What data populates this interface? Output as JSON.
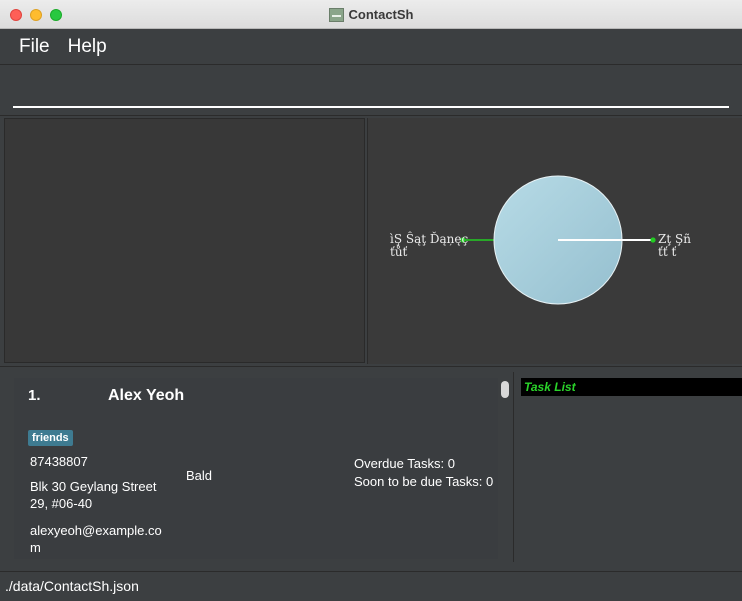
{
  "window": {
    "title": "ContactSh"
  },
  "menu": {
    "file": "File",
    "help": "Help"
  },
  "command": {
    "value": "",
    "placeholder": ""
  },
  "graph": {
    "left_node_label_line1": "ìŞ Ŝąţ Ďąņęç",
    "left_node_label_line2": "ťůť",
    "right_node_label_line1": "Zţ Şñ",
    "right_node_label_line2": "ťť ť"
  },
  "person_card": {
    "index": "1.",
    "name": "Alex Yeoh",
    "tag": "friends",
    "phone": "87438807",
    "address": "Blk 30 Geylang Street 29, #06-40",
    "email": "alexyeoh@example.com",
    "remark": "Bald",
    "overdue_tasks": "Overdue Tasks: 0",
    "soon_due_tasks": "Soon to be due Tasks: 0"
  },
  "task_list": {
    "header": "Task List"
  },
  "status_bar": {
    "file_path": "./data/ContactSh.json"
  },
  "colors": {
    "background": "#3c3f41",
    "tag_background": "#3e7b91",
    "task_header_text": "#2ad32a",
    "node_dot": "#22cc22"
  }
}
